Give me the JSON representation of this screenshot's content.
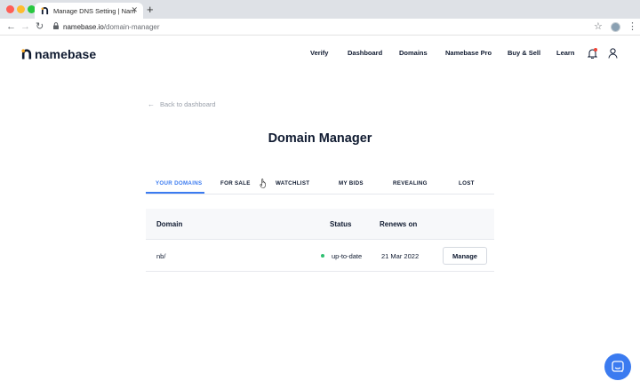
{
  "browser": {
    "tab_title": "Manage DNS Setting | Nameba",
    "url_host": "namebase.io",
    "url_path": "/domain-manager"
  },
  "header": {
    "logo_text": "namebase",
    "nav": [
      "Verify",
      "Dashboard",
      "Domains",
      "Namebase Pro",
      "Buy & Sell",
      "Learn"
    ]
  },
  "main": {
    "back_label": "Back to dashboard",
    "title": "Domain Manager",
    "tabs": [
      "YOUR DOMAINS",
      "FOR SALE",
      "WATCHLIST",
      "MY BIDS",
      "REVEALING",
      "LOST"
    ],
    "active_tab": "YOUR DOMAINS",
    "table": {
      "headers": {
        "domain": "Domain",
        "status": "Status",
        "renews": "Renews on"
      },
      "rows": [
        {
          "domain": "nb/",
          "status": "up-to-date",
          "renews": "21 Mar 2022",
          "action": "Manage"
        }
      ]
    }
  },
  "colors": {
    "accent": "#3b7bf0",
    "status_ok": "#2fbf71",
    "notification": "#f04438"
  }
}
